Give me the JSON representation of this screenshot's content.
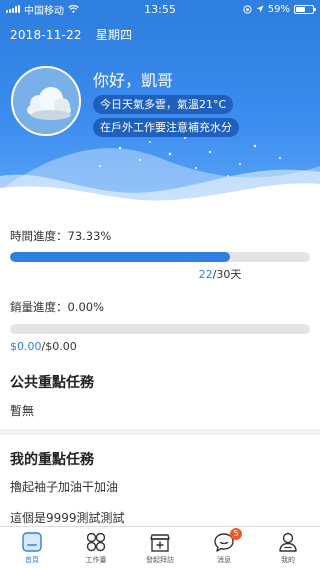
{
  "status_bar": {
    "carrier": "中国移动",
    "time": "13:55",
    "battery": "59%",
    "battery_level": 0.59
  },
  "header": {
    "date": "2018-11-22",
    "weekday": "星期四",
    "greeting": "你好，凱哥",
    "weather_line": "今日天氣多雲，氣溫21°C",
    "advice_line": "在戶外工作要注意補充水分",
    "colors": {
      "primary": "#2f7fe1",
      "pill": "#1f5fbe"
    }
  },
  "time_progress": {
    "label": "時間進度：73.33%",
    "value": 0.7333,
    "current": "22",
    "total": "/30天"
  },
  "sales_progress": {
    "label": "銷量進度：0.00%",
    "value": 0.0,
    "current": "$0.00",
    "total": "/$0.00"
  },
  "public_tasks": {
    "title": "公共重點任務",
    "items": [
      "暫無"
    ]
  },
  "my_tasks": {
    "title": "我的重點任務",
    "items": [
      "擼起袖子加油干加油",
      "這個是9999測試測試"
    ]
  },
  "tab_bar": {
    "tabs": [
      {
        "label": "首頁",
        "icon": "home-icon",
        "active": true
      },
      {
        "label": "工作臺",
        "icon": "grid-icon",
        "active": false
      },
      {
        "label": "發起拜訪",
        "icon": "shop-add-icon",
        "active": false
      },
      {
        "label": "消息",
        "icon": "chat-icon",
        "active": false,
        "badge": "5"
      },
      {
        "label": "我的",
        "icon": "user-icon",
        "active": false
      }
    ]
  }
}
